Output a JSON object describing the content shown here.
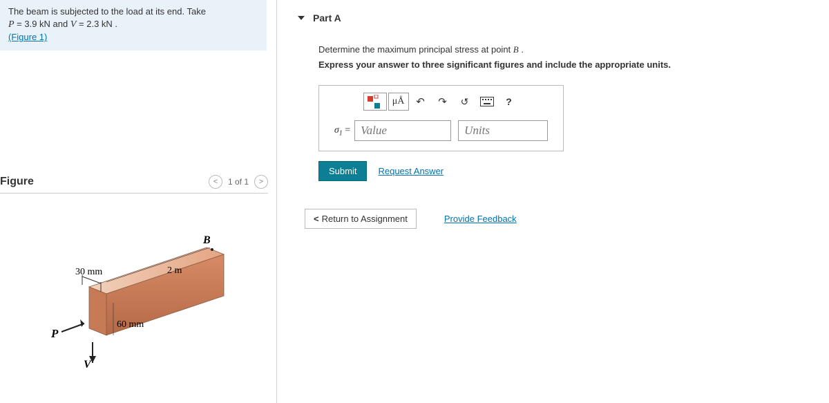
{
  "problem": {
    "line1_a": "The beam is subjected to the load at its end. Take",
    "line2_a": "P",
    "line2_b": " = 3.9  kN and ",
    "line2_c": "V",
    "line2_d": " = 2.3  kN .",
    "figure_link": "(Figure 1)"
  },
  "figure": {
    "title": "Figure",
    "nav_prev": "<",
    "nav_label": "1 of 1",
    "nav_next": ">",
    "label_B": "B",
    "label_width": "30 mm",
    "label_height": "60 mm",
    "label_length": "2 m",
    "label_P": "P",
    "label_V": "V"
  },
  "part": {
    "title": "Part A",
    "question_a": "Determine the maximum principal stress at point ",
    "question_b": "B",
    "question_c": " .",
    "instruction": "Express your answer to three significant figures and include the appropriate units."
  },
  "toolbar": {
    "mua": "μÅ",
    "help": "?"
  },
  "answer": {
    "sigma": "σ",
    "sub": "1",
    "eq": " =",
    "value_placeholder": "Value",
    "units_placeholder": "Units"
  },
  "actions": {
    "submit": "Submit",
    "request": "Request Answer",
    "return": "Return to Assignment",
    "feedback": "Provide Feedback"
  }
}
